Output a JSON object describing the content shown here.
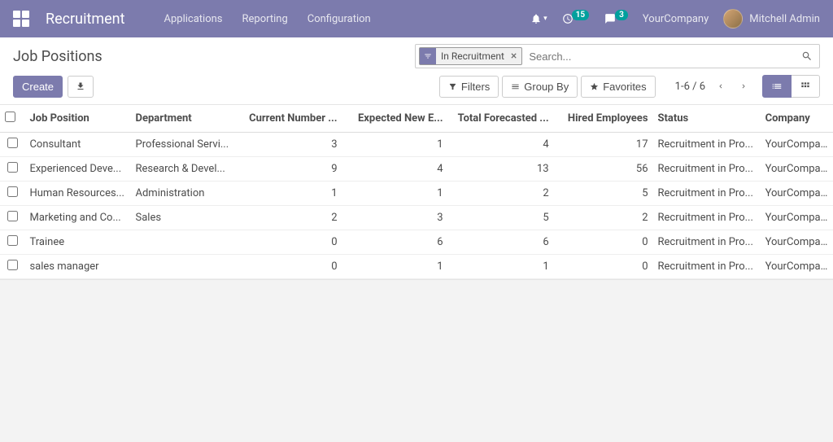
{
  "nav": {
    "brand": "Recruitment",
    "menu": [
      "Applications",
      "Reporting",
      "Configuration"
    ],
    "activity_count": "15",
    "message_count": "3",
    "company": "YourCompany",
    "user": "Mitchell Admin"
  },
  "breadcrumb": "Job Positions",
  "search": {
    "facet_label": "In Recruitment",
    "placeholder": "Search..."
  },
  "buttons": {
    "create": "Create",
    "filters": "Filters",
    "groupby": "Group By",
    "favorites": "Favorites"
  },
  "pager": "1-6 / 6",
  "columns": {
    "position": "Job Position",
    "department": "Department",
    "current": "Current Number ...",
    "expected": "Expected New E...",
    "total": "Total Forecasted ...",
    "hired": "Hired Employees",
    "status": "Status",
    "company": "Company"
  },
  "rows": [
    {
      "position": "Consultant",
      "department": "Professional Servi...",
      "current": "3",
      "expected": "1",
      "total": "4",
      "hired": "17",
      "status": "Recruitment in Pro...",
      "company": "YourCompany"
    },
    {
      "position": "Experienced Deve...",
      "department": "Research & Devel...",
      "current": "9",
      "expected": "4",
      "total": "13",
      "hired": "56",
      "status": "Recruitment in Pro...",
      "company": "YourCompany"
    },
    {
      "position": "Human Resources...",
      "department": "Administration",
      "current": "1",
      "expected": "1",
      "total": "2",
      "hired": "5",
      "status": "Recruitment in Pro...",
      "company": "YourCompany"
    },
    {
      "position": "Marketing and Co...",
      "department": "Sales",
      "current": "2",
      "expected": "3",
      "total": "5",
      "hired": "2",
      "status": "Recruitment in Pro...",
      "company": "YourCompany"
    },
    {
      "position": "Trainee",
      "department": "",
      "current": "0",
      "expected": "6",
      "total": "6",
      "hired": "0",
      "status": "Recruitment in Pro...",
      "company": "YourCompany"
    },
    {
      "position": "sales manager",
      "department": "",
      "current": "0",
      "expected": "1",
      "total": "1",
      "hired": "0",
      "status": "Recruitment in Pro...",
      "company": "YourCompany"
    }
  ]
}
